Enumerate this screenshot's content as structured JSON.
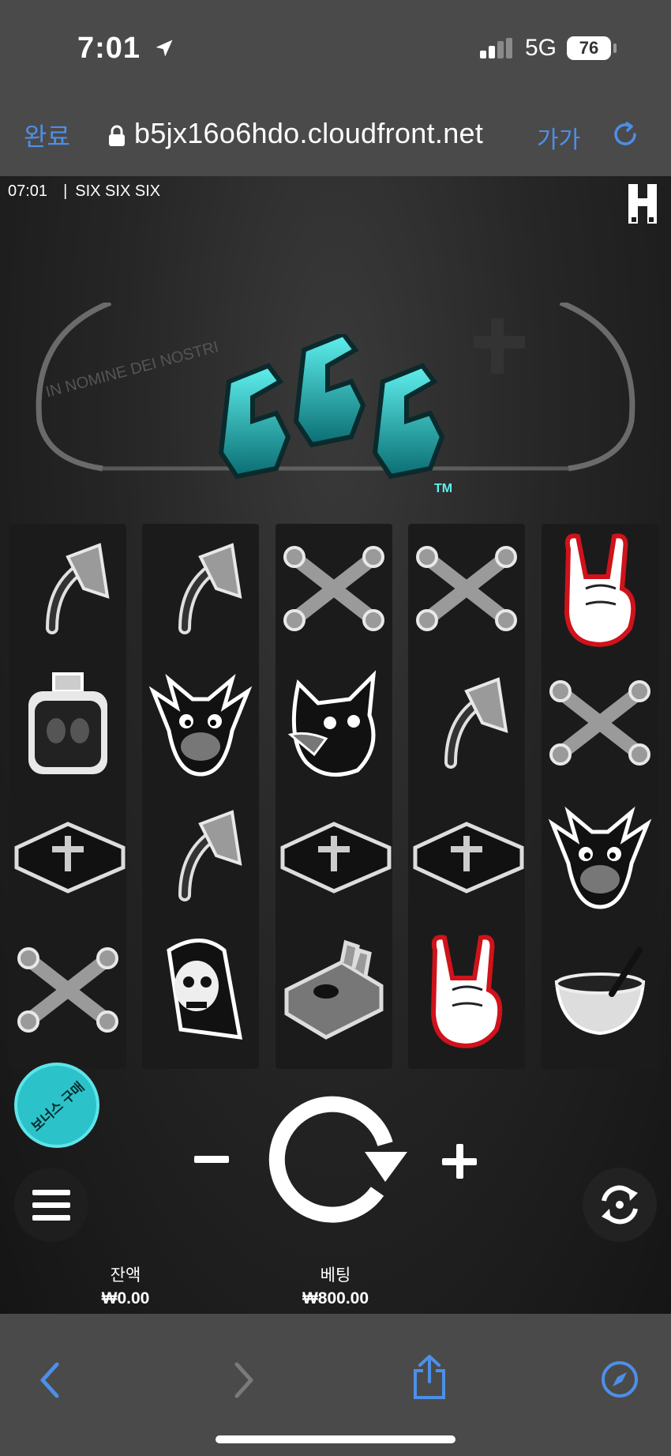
{
  "status_bar": {
    "time": "7:01",
    "network": "5G",
    "battery": "76"
  },
  "browser": {
    "done_label": "완료",
    "url": "b5jx16o6hdo.cloudfront.net",
    "text_size_label": "가가"
  },
  "game": {
    "clock": "07:01",
    "title": "SIX SIX SIX",
    "bonus_buy_label": "보너스 구매",
    "balance": {
      "label": "잔액",
      "value": "₩0.00"
    },
    "bet": {
      "label": "베팅",
      "value": "₩800.00"
    },
    "reels": [
      [
        "axe",
        "potion-bottle",
        "inverted-cross-book",
        "crossed-bones"
      ],
      [
        "axe",
        "goat-head",
        "axe",
        "grim-reaper"
      ],
      [
        "crossed-bones",
        "wolf-head",
        "inverted-cross-book",
        "cigarette-pack"
      ],
      [
        "crossed-bones",
        "axe",
        "inverted-cross-book",
        "rock-hand"
      ],
      [
        "rock-hand",
        "crossed-bones",
        "goat-head",
        "potion-bowl"
      ]
    ]
  },
  "colors": {
    "accent_cyan": "#2bc3c9",
    "ios_blue": "#4d8fe8",
    "rock_hand_outline": "#d0121b"
  }
}
